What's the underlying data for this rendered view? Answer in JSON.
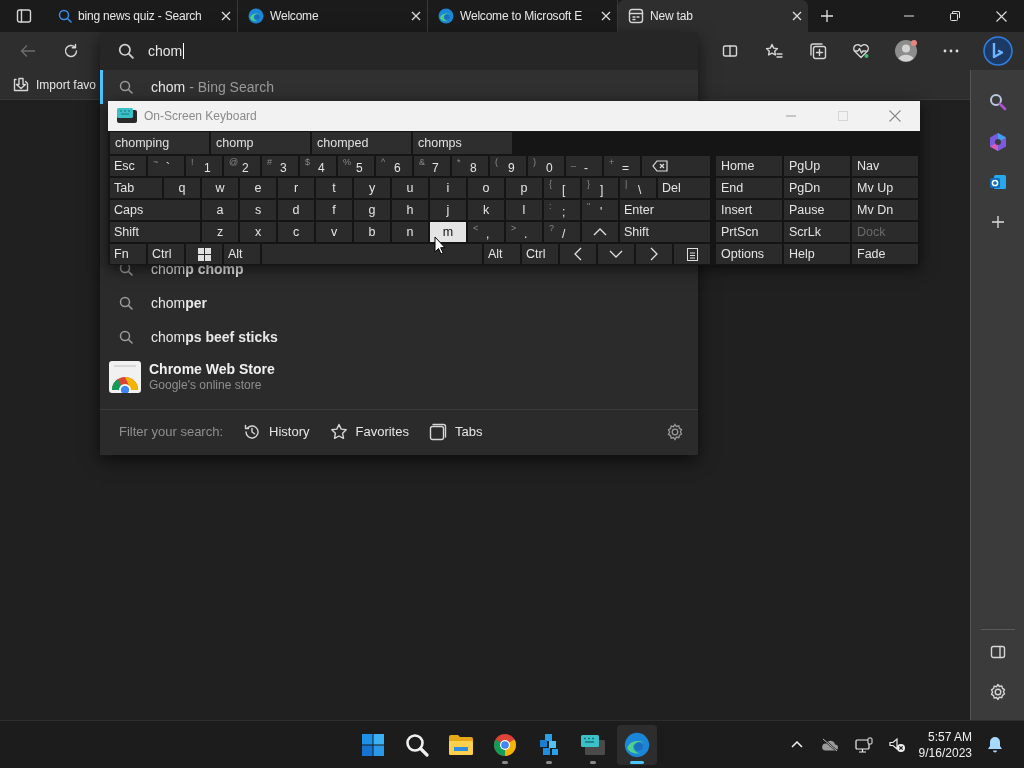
{
  "tabs": [
    {
      "title": "bing news quiz - Search",
      "kind": "search",
      "selected": false
    },
    {
      "title": "Welcome",
      "kind": "edge",
      "selected": false
    },
    {
      "title": "Welcome to Microsoft E",
      "kind": "edge",
      "selected": false
    },
    {
      "title": "New tab",
      "kind": "newtab",
      "selected": true
    }
  ],
  "address_bar": {
    "value": "chom"
  },
  "favorites_bar": {
    "items": [
      {
        "label": "Import favo"
      }
    ]
  },
  "suggestions": [
    {
      "kind": "search",
      "text": "chom",
      "suffix": "- Bing Search",
      "selected": true
    },
    {
      "kind": "search",
      "text": "chom**p chomp**",
      "selected": false
    },
    {
      "kind": "search",
      "text": "chom**per**",
      "selected": false
    },
    {
      "kind": "search",
      "text": "chom**ps beef sticks**",
      "selected": false
    },
    {
      "kind": "site",
      "title": "Chrome Web Store",
      "subtitle": "Google's online store",
      "selected": false
    }
  ],
  "filter": {
    "label": "Filter your search:",
    "options": [
      {
        "kind": "history",
        "label": "History"
      },
      {
        "kind": "star",
        "label": "Favorites"
      },
      {
        "kind": "tabs",
        "label": "Tabs"
      }
    ]
  },
  "osk": {
    "title": "On-Screen Keyboard",
    "predictions": [
      "chomping",
      "chomp",
      "chomped",
      "chomps"
    ],
    "rows": [
      {
        "keys": [
          {
            "kind": "text",
            "main": "Esc",
            "hover": false
          },
          {
            "kind": "sym",
            "shift": "~",
            "main": "`",
            "hover": false
          },
          {
            "kind": "sym",
            "shift": "!",
            "main": "1",
            "hover": false
          },
          {
            "kind": "sym",
            "shift": "@",
            "main": "2",
            "hover": false
          },
          {
            "kind": "sym",
            "shift": "#",
            "main": "3",
            "hover": false
          },
          {
            "kind": "sym",
            "shift": "$",
            "main": "4",
            "hover": false
          },
          {
            "kind": "sym",
            "shift": "%",
            "main": "5",
            "hover": false
          },
          {
            "kind": "sym",
            "shift": "^",
            "main": "6",
            "hover": false
          },
          {
            "kind": "sym",
            "shift": "&",
            "main": "7",
            "hover": false
          },
          {
            "kind": "sym",
            "shift": "*",
            "main": "8",
            "hover": false
          },
          {
            "kind": "sym",
            "shift": "(",
            "main": "9",
            "hover": false
          },
          {
            "kind": "sym",
            "shift": ")",
            "main": "0",
            "hover": false
          },
          {
            "kind": "sym",
            "shift": "_",
            "main": "-",
            "hover": false
          },
          {
            "kind": "sym",
            "shift": "+",
            "main": "=",
            "hover": false
          },
          {
            "kind": "backspace",
            "hover": false
          }
        ]
      },
      {
        "keys": [
          {
            "kind": "wide",
            "main": "Tab",
            "hover": false
          },
          {
            "kind": "letter",
            "main": "q",
            "hover": false
          },
          {
            "kind": "letter",
            "main": "w",
            "hover": false
          },
          {
            "kind": "letter",
            "main": "e",
            "hover": false
          },
          {
            "kind": "letter",
            "main": "r",
            "hover": false
          },
          {
            "kind": "letter",
            "main": "t",
            "hover": false
          },
          {
            "kind": "letter",
            "main": "y",
            "hover": false
          },
          {
            "kind": "letter",
            "main": "u",
            "hover": false
          },
          {
            "kind": "letter",
            "main": "i",
            "hover": false
          },
          {
            "kind": "letter",
            "main": "o",
            "hover": false
          },
          {
            "kind": "letter",
            "main": "p",
            "hover": false
          },
          {
            "kind": "sym",
            "shift": "{",
            "main": "[",
            "hover": false
          },
          {
            "kind": "sym",
            "shift": "}",
            "main": "]",
            "hover": false
          },
          {
            "kind": "sym",
            "shift": "|",
            "main": "\\",
            "hover": false
          },
          {
            "kind": "wide",
            "main": "Del",
            "hover": false
          }
        ]
      },
      {
        "keys": [
          {
            "kind": "wide",
            "main": "Caps",
            "hover": false
          },
          {
            "kind": "letter",
            "main": "a",
            "hover": false
          },
          {
            "kind": "letter",
            "main": "s",
            "hover": false
          },
          {
            "kind": "letter",
            "main": "d",
            "hover": false
          },
          {
            "kind": "letter",
            "main": "f",
            "hover": false
          },
          {
            "kind": "letter",
            "main": "g",
            "hover": false
          },
          {
            "kind": "letter",
            "main": "h",
            "hover": false
          },
          {
            "kind": "letter",
            "main": "j",
            "hover": false
          },
          {
            "kind": "letter",
            "main": "k",
            "hover": false
          },
          {
            "kind": "letter",
            "main": "l",
            "hover": false
          },
          {
            "kind": "sym",
            "shift": ":",
            "main": ";",
            "hover": false
          },
          {
            "kind": "sym",
            "shift": "\"",
            "main": "'",
            "hover": false
          },
          {
            "kind": "wide",
            "main": "Enter",
            "hover": false
          }
        ]
      },
      {
        "keys": [
          {
            "kind": "wide",
            "main": "Shift",
            "hover": false
          },
          {
            "kind": "letter",
            "main": "z",
            "hover": false
          },
          {
            "kind": "letter",
            "main": "x",
            "hover": false
          },
          {
            "kind": "letter",
            "main": "c",
            "hover": false
          },
          {
            "kind": "letter",
            "main": "v",
            "hover": false
          },
          {
            "kind": "letter",
            "main": "b",
            "hover": false
          },
          {
            "kind": "letter",
            "main": "n",
            "hover": false
          },
          {
            "kind": "letter",
            "main": "m",
            "hover": true
          },
          {
            "kind": "sym",
            "shift": "<",
            "main": ",",
            "hover": false
          },
          {
            "kind": "sym",
            "shift": ">",
            "main": ".",
            "hover": false
          },
          {
            "kind": "sym",
            "shift": "?",
            "main": "/",
            "hover": false
          },
          {
            "kind": "up",
            "hover": false
          },
          {
            "kind": "wide",
            "main": "Shift",
            "hover": false
          }
        ]
      },
      {
        "keys": [
          {
            "kind": "text",
            "main": "Fn",
            "hover": false
          },
          {
            "kind": "text",
            "main": "Ctrl",
            "hover": false
          },
          {
            "kind": "windows",
            "hover": false
          },
          {
            "kind": "text",
            "main": "Alt",
            "hover": false
          },
          {
            "kind": "space",
            "hover": false
          },
          {
            "kind": "text",
            "main": "Alt",
            "hover": false
          },
          {
            "kind": "text",
            "main": "Ctrl",
            "hover": false
          },
          {
            "kind": "left",
            "hover": false
          },
          {
            "kind": "down",
            "hover": false
          },
          {
            "kind": "right",
            "hover": false
          },
          {
            "kind": "menu",
            "hover": false
          }
        ]
      }
    ],
    "nav_rows": [
      [
        {
          "label": "Home",
          "disabled": false
        },
        {
          "label": "PgUp",
          "disabled": false
        },
        {
          "label": "Nav",
          "disabled": false
        }
      ],
      [
        {
          "label": "End",
          "disabled": false
        },
        {
          "label": "PgDn",
          "disabled": false
        },
        {
          "label": "Mv Up",
          "disabled": false
        }
      ],
      [
        {
          "label": "Insert",
          "disabled": false
        },
        {
          "label": "Pause",
          "disabled": false
        },
        {
          "label": "Mv Dn",
          "disabled": false
        }
      ],
      [
        {
          "label": "PrtScn",
          "disabled": false
        },
        {
          "label": "ScrLk",
          "disabled": false
        },
        {
          "label": "Dock",
          "disabled": true
        }
      ],
      [
        {
          "label": "Options",
          "disabled": false
        },
        {
          "label": "Help",
          "disabled": false
        },
        {
          "label": "Fade",
          "disabled": false
        }
      ]
    ]
  },
  "taskbar": {
    "apps": [
      {
        "kind": "start",
        "running": false,
        "active": false
      },
      {
        "kind": "search",
        "running": false,
        "active": false
      },
      {
        "kind": "files",
        "running": false,
        "active": false
      },
      {
        "kind": "chrome",
        "running": true,
        "active": false
      },
      {
        "kind": "cubes",
        "running": true,
        "active": false
      },
      {
        "kind": "keyboard",
        "running": true,
        "active": false
      },
      {
        "kind": "edge",
        "running": true,
        "active": true
      }
    ],
    "time": "5:57 AM",
    "date": "9/16/2023"
  }
}
